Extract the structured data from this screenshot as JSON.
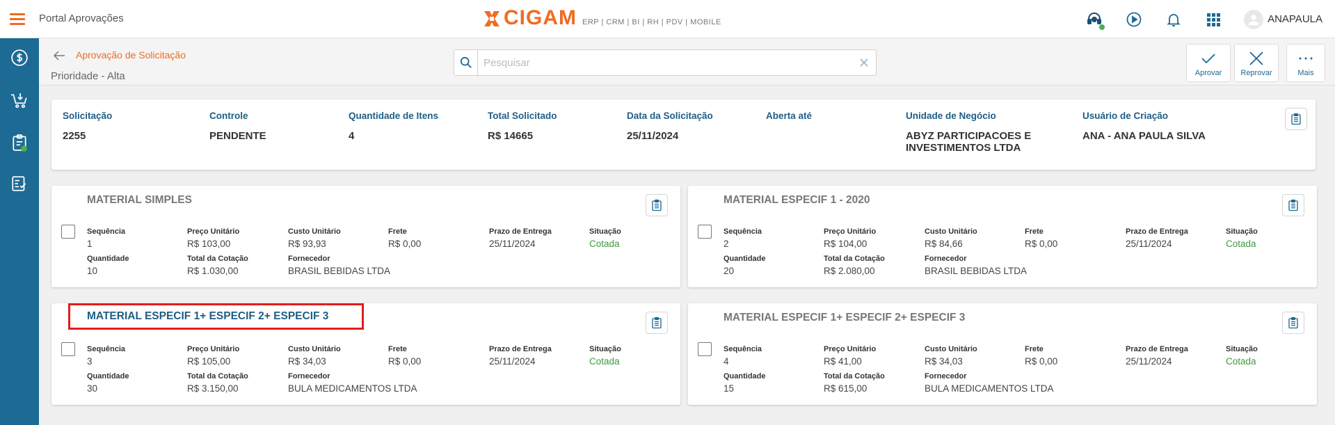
{
  "app": {
    "portal_title": "Portal Aprovações",
    "logo_text": "CIGAM",
    "logo_sub": "ERP | CRM | BI | RH | PDV | MOBILE",
    "user_name": "ANAPAULA",
    "accent_color": "#ef6c22",
    "brand_color": "#1d6a94"
  },
  "top_icons": [
    "support-agent-icon",
    "play-circle-icon",
    "bell-icon",
    "apps-grid-icon",
    "user-avatar-icon"
  ],
  "sidebar_icons": [
    "dollar-circle-icon",
    "cart-download-icon",
    "clipboard-check-icon",
    "form-approval-icon"
  ],
  "header": {
    "breadcrumb": "Aprovação de Solicitação",
    "priority": "Prioridade - Alta",
    "search_placeholder": "Pesquisar",
    "search_value": "",
    "actions": {
      "approve": "Aprovar",
      "reject": "Reprovar",
      "more": "Mais"
    }
  },
  "summary": {
    "fields": [
      {
        "label": "Solicitação",
        "value": "2255"
      },
      {
        "label": "Controle",
        "value": "PENDENTE"
      },
      {
        "label": "Quantidade de Itens",
        "value": "4"
      },
      {
        "label": "Total Solicitado",
        "value": "R$ 14665"
      },
      {
        "label": "Data da Solicitação",
        "value": "25/11/2024"
      },
      {
        "label": "Aberta até",
        "value": ""
      },
      {
        "label": "Unidade de Negócio",
        "value": "ABYZ PARTICIPACOES E INVESTIMENTOS LTDA"
      },
      {
        "label": "Usuário de Criação",
        "value": "ANA - ANA PAULA SILVA"
      }
    ]
  },
  "field_labels": {
    "seq": "Sequência",
    "unit_price": "Preço Unitário",
    "unit_cost": "Custo Unitário",
    "freight": "Frete",
    "delivery": "Prazo de Entrega",
    "status": "Situação",
    "qty": "Quantidade",
    "total": "Total da Cotação",
    "supplier": "Fornecedor"
  },
  "items": [
    {
      "title": "MATERIAL SIMPLES",
      "seq": "1",
      "unit_price": "R$ 103,00",
      "unit_cost": "R$ 93,93",
      "freight": "R$ 0,00",
      "delivery": "25/11/2024",
      "status": "Cotada",
      "qty": "10",
      "total": "R$ 1.030,00",
      "supplier": "BRASIL BEBIDAS LTDA"
    },
    {
      "title": "MATERIAL ESPECIF 1 - 2020",
      "seq": "2",
      "unit_price": "R$ 104,00",
      "unit_cost": "R$ 84,66",
      "freight": "R$ 0,00",
      "delivery": "25/11/2024",
      "status": "Cotada",
      "qty": "20",
      "total": "R$ 2.080,00",
      "supplier": "BRASIL BEBIDAS LTDA"
    },
    {
      "title": "MATERIAL ESPECIF 1+ ESPECIF 2+ ESPECIF 3",
      "seq": "3",
      "unit_price": "R$ 105,00",
      "unit_cost": "R$ 34,03",
      "freight": "R$ 0,00",
      "delivery": "25/11/2024",
      "status": "Cotada",
      "qty": "30",
      "total": "R$ 3.150,00",
      "supplier": "BULA MEDICAMENTOS LTDA"
    },
    {
      "title": "MATERIAL ESPECIF 1+ ESPECIF 2+ ESPECIF 3",
      "seq": "4",
      "unit_price": "R$ 41,00",
      "unit_cost": "R$ 34,03",
      "freight": "R$ 0,00",
      "delivery": "25/11/2024",
      "status": "Cotada",
      "qty": "15",
      "total": "R$ 615,00",
      "supplier": "BULA MEDICAMENTOS LTDA"
    }
  ]
}
